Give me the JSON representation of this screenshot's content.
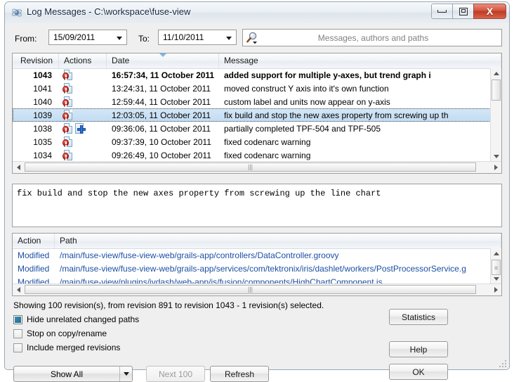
{
  "window": {
    "title": "Log Messages - C:\\workspace\\fuse-view",
    "icon": "tortoisesvn-icon",
    "minimize_label": "Minimize",
    "maximize_label": "Maximize",
    "close_label": "X"
  },
  "filter": {
    "from_label": "From:",
    "from_value": "15/09/2011",
    "to_label": "To:",
    "to_value": "11/10/2011",
    "search_placeholder": "Messages, authors and paths",
    "search_value": ""
  },
  "revisions": {
    "columns": [
      "Revision",
      "Actions",
      "Date",
      "Message"
    ],
    "sorted_column": "Date",
    "rows": [
      {
        "revision": "1043",
        "actions": [
          "modified"
        ],
        "date": "16:57:34, 11 October 2011",
        "message": "added support for multiple y-axes, but trend graph i",
        "bold": true,
        "selected": false
      },
      {
        "revision": "1041",
        "actions": [
          "modified"
        ],
        "date": "13:24:31, 11 October 2011",
        "message": "moved construct Y axis into it's own function",
        "bold": false,
        "selected": false
      },
      {
        "revision": "1040",
        "actions": [
          "modified"
        ],
        "date": "12:59:44, 11 October 2011",
        "message": "custom label and units now appear on y-axis",
        "bold": false,
        "selected": false
      },
      {
        "revision": "1039",
        "actions": [
          "modified"
        ],
        "date": "12:03:05, 11 October 2011",
        "message": "fix build and stop the new axes property from screwing up th",
        "bold": false,
        "selected": true
      },
      {
        "revision": "1038",
        "actions": [
          "modified",
          "added"
        ],
        "date": "09:36:06, 11 October 2011",
        "message": "partially completed TPF-504 and TPF-505",
        "bold": false,
        "selected": false
      },
      {
        "revision": "1035",
        "actions": [
          "modified"
        ],
        "date": "09:37:39, 10 October 2011",
        "message": "fixed codenarc warning",
        "bold": false,
        "selected": false
      },
      {
        "revision": "1034",
        "actions": [
          "modified"
        ],
        "date": "09:26:49, 10 October 2011",
        "message": "fixed codenarc warning",
        "bold": false,
        "selected": false
      }
    ]
  },
  "message_detail": {
    "text": "fix build and stop the new axes property from screwing up the line chart"
  },
  "paths": {
    "columns": [
      "Action",
      "Path"
    ],
    "rows": [
      {
        "action": "Modified",
        "path": "/main/fuse-view/fuse-view-web/grails-app/controllers/DataController.groovy"
      },
      {
        "action": "Modified",
        "path": "/main/fuse-view/fuse-view-web/grails-app/services/com/tektronix/iris/dashlet/workers/PostProcessorService.g"
      },
      {
        "action": "Modified",
        "path": "/main/fuse-view/plugins/ivdash/web-app/js/fusion/components/HighChartComponent.js"
      }
    ]
  },
  "status": {
    "text": "Showing 100 revision(s), from revision 891 to revision 1043 - 1 revision(s) selected."
  },
  "checkboxes": [
    {
      "label": "Hide unrelated changed paths",
      "checked": true
    },
    {
      "label": "Stop on copy/rename",
      "checked": false
    },
    {
      "label": "Include merged revisions",
      "checked": false
    }
  ],
  "buttons": {
    "statistics": "Statistics",
    "help": "Help",
    "ok": "OK",
    "show_all": "Show All",
    "next_100": "Next 100",
    "refresh": "Refresh"
  },
  "colors": {
    "selection": "#c2dcf2",
    "path_link": "#1c4fa3",
    "checkbox_fill": "#1f6d92",
    "close_button": "#bf3a22"
  }
}
